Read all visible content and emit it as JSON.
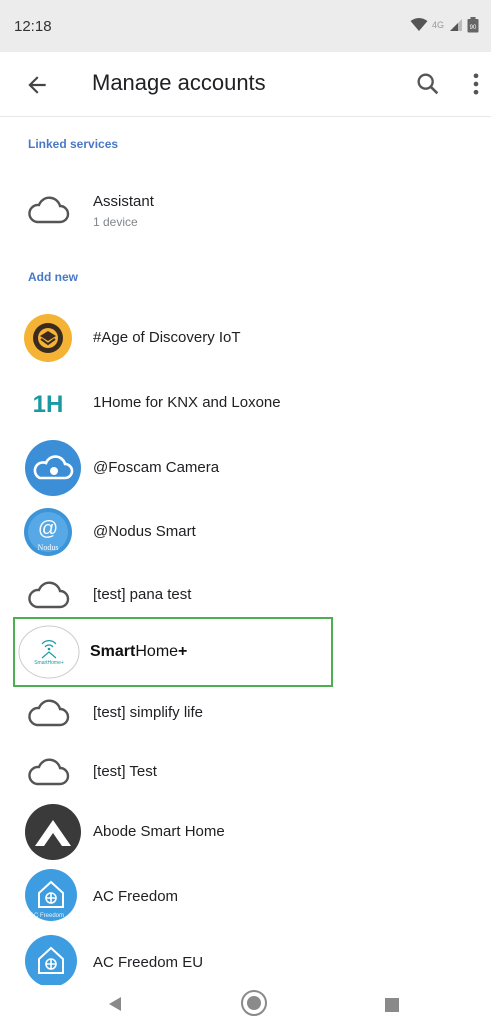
{
  "status": {
    "time": "12:18",
    "network": "4G",
    "battery": "90"
  },
  "app_bar": {
    "title": "Manage accounts",
    "back_icon": "arrow-back-icon",
    "search_icon": "search-icon",
    "more_icon": "more-vert-icon"
  },
  "sections": {
    "linked": "Linked services",
    "add_new": "Add new"
  },
  "linked_services": [
    {
      "name": "Assistant",
      "detail": "1 device",
      "icon": "cloud-icon"
    }
  ],
  "add_new": [
    {
      "name": "#Age of Discovery IoT",
      "icon": "age-of-discovery-logo"
    },
    {
      "name": "1Home for KNX and Loxone",
      "icon": "1home-logo",
      "logo_text": "1H"
    },
    {
      "name": "@Foscam Camera",
      "icon": "foscam-logo"
    },
    {
      "name": "@Nodus Smart",
      "icon": "nodus-logo",
      "logo_text": "Nodus"
    },
    {
      "name": "[test] pana test",
      "icon": "cloud-icon"
    },
    {
      "name_bold": "Smart",
      "name_rest": "Home",
      "name_plus": "+",
      "icon": "smarthome-plus-logo",
      "logo_text": "SmartHome+"
    },
    {
      "name": "[test] simplify life",
      "icon": "cloud-icon"
    },
    {
      "name": "[test] Test",
      "icon": "cloud-icon"
    },
    {
      "name": "Abode Smart Home",
      "icon": "abode-logo"
    },
    {
      "name": "AC Freedom",
      "icon": "ac-freedom-logo",
      "logo_text": "AC Freedom"
    },
    {
      "name": "AC Freedom EU",
      "icon": "ac-freedom-logo"
    }
  ],
  "colors": {
    "section_label": "#4a79c4",
    "highlight_border": "#4caf50",
    "foscam_blue": "#3c8fd6",
    "age_orange": "#f5b335",
    "onehome_teal": "#1a9aa0"
  },
  "nav": {
    "back": "nav-back-icon",
    "home": "nav-home-icon",
    "recents": "nav-recents-icon"
  }
}
